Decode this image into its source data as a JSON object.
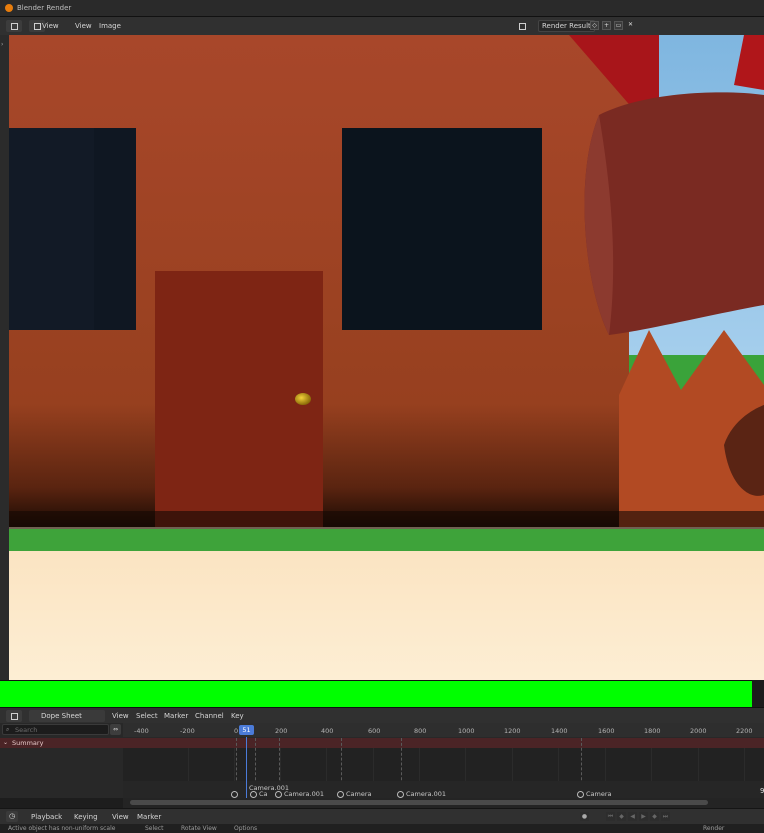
{
  "window": {
    "title": "Blender Render"
  },
  "image_editor": {
    "menus": [
      "View",
      "View",
      "Image"
    ],
    "image_name": "Render Result"
  },
  "dope_sheet": {
    "mode": "Dope Sheet",
    "menus": [
      "View",
      "Select",
      "Marker",
      "Channel",
      "Key"
    ],
    "search_placeholder": "Search",
    "summary_label": "Summary",
    "current_frame": "51",
    "ruler_ticks": [
      "-400",
      "-200",
      "0",
      "200",
      "400",
      "600",
      "800",
      "1000",
      "1200",
      "1400",
      "1600",
      "1800",
      "2000",
      "2200"
    ],
    "markers": [
      {
        "label": "Camera.001"
      },
      {
        "label": "Ca"
      },
      {
        "label": "Camera.001"
      },
      {
        "label": "Camera"
      },
      {
        "label": "Camera.001"
      },
      {
        "label": "Camera"
      }
    ],
    "edge_number": "9"
  },
  "timeline": {
    "menus": [
      "Playback",
      "Keying",
      "View",
      "Marker"
    ],
    "right_label": "Render"
  },
  "status_bar": {
    "message": "Active object has non-uniform scale",
    "items": [
      "Select",
      "Rotate View",
      "Options"
    ]
  },
  "colors": {
    "accent_blue": "#4b7bd9",
    "progress_green": "#00ff00",
    "summary_red": "#4b2426"
  }
}
